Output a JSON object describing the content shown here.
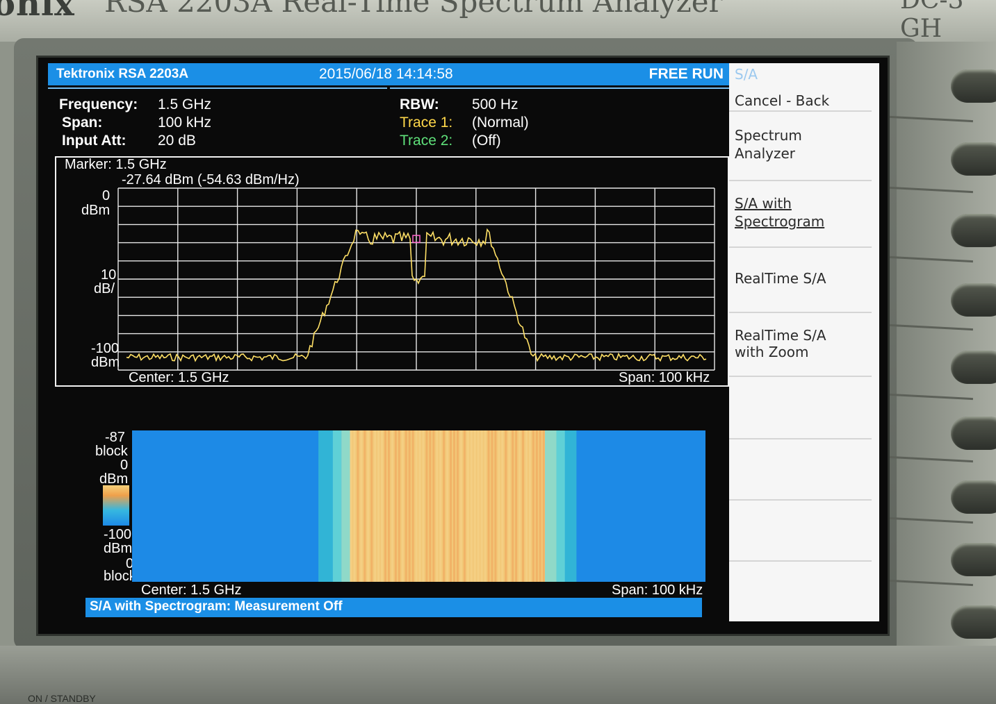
{
  "bezel": {
    "brand_partial": "onix",
    "model_title": "RSA 2203A Real-Time Spectrum Analyzer",
    "freq_range_partial": "DC-3 GH",
    "standby_label": "ON / STANDBY"
  },
  "header": {
    "logo": "Tektronix RSA 2203A",
    "datetime": "2015/06/18 14:14:58",
    "run_mode": "FREE RUN"
  },
  "params": {
    "frequency_label": "Frequency:",
    "frequency_value": "1.5 GHz",
    "span_label": "Span:",
    "span_value": "100 kHz",
    "input_att_label": "Input Att:",
    "input_att_value": "20 dB",
    "rbw_label": "RBW:",
    "rbw_value": "500 Hz",
    "trace1_label": "Trace 1:",
    "trace1_value": "(Normal)",
    "trace2_label": "Trace 2:",
    "trace2_value": "(Off)"
  },
  "spectrum": {
    "marker_line1": "Marker: 1.5 GHz",
    "marker_line2": "-27.64 dBm (-54.63 dBm/Hz)",
    "ref_level": "0",
    "ref_unit": "dBm",
    "scale_value": "10",
    "scale_unit": "dB/",
    "bottom_level": "-100",
    "bottom_unit": "dBm",
    "center_label": "Center: 1.5 GHz",
    "span_label": "Span: 100 kHz",
    "trace_color": "#ffe066",
    "grid_color": "#e8e8e8"
  },
  "spectrogram": {
    "top_value": "-87",
    "top_unit": "block",
    "scale_top_value": "0",
    "scale_top_unit": "dBm",
    "scale_bottom_value": "-100",
    "scale_bottom_unit": "dBm",
    "bottom_value": "0",
    "bottom_unit": "block",
    "center_label": "Center: 1.5 GHz",
    "span_label": "Span: 100 kHz"
  },
  "status_bar": {
    "text": "S/A with Spectrogram: Measurement Off"
  },
  "menu": {
    "title": "S/A",
    "items": [
      {
        "line1": "Cancel - Back",
        "line2": ""
      },
      {
        "line1": "Spectrum",
        "line2": "Analyzer"
      },
      {
        "line1": "S/A with",
        "line2": "Spectrogram"
      },
      {
        "line1": "RealTime S/A",
        "line2": ""
      },
      {
        "line1": "RealTime S/A",
        "line2": "with Zoom"
      }
    ]
  },
  "colors": {
    "header_blue": "#1b8fe6",
    "spectrogram_blue": "#1d8ae6",
    "spectrogram_signal": "#f2c878"
  }
}
